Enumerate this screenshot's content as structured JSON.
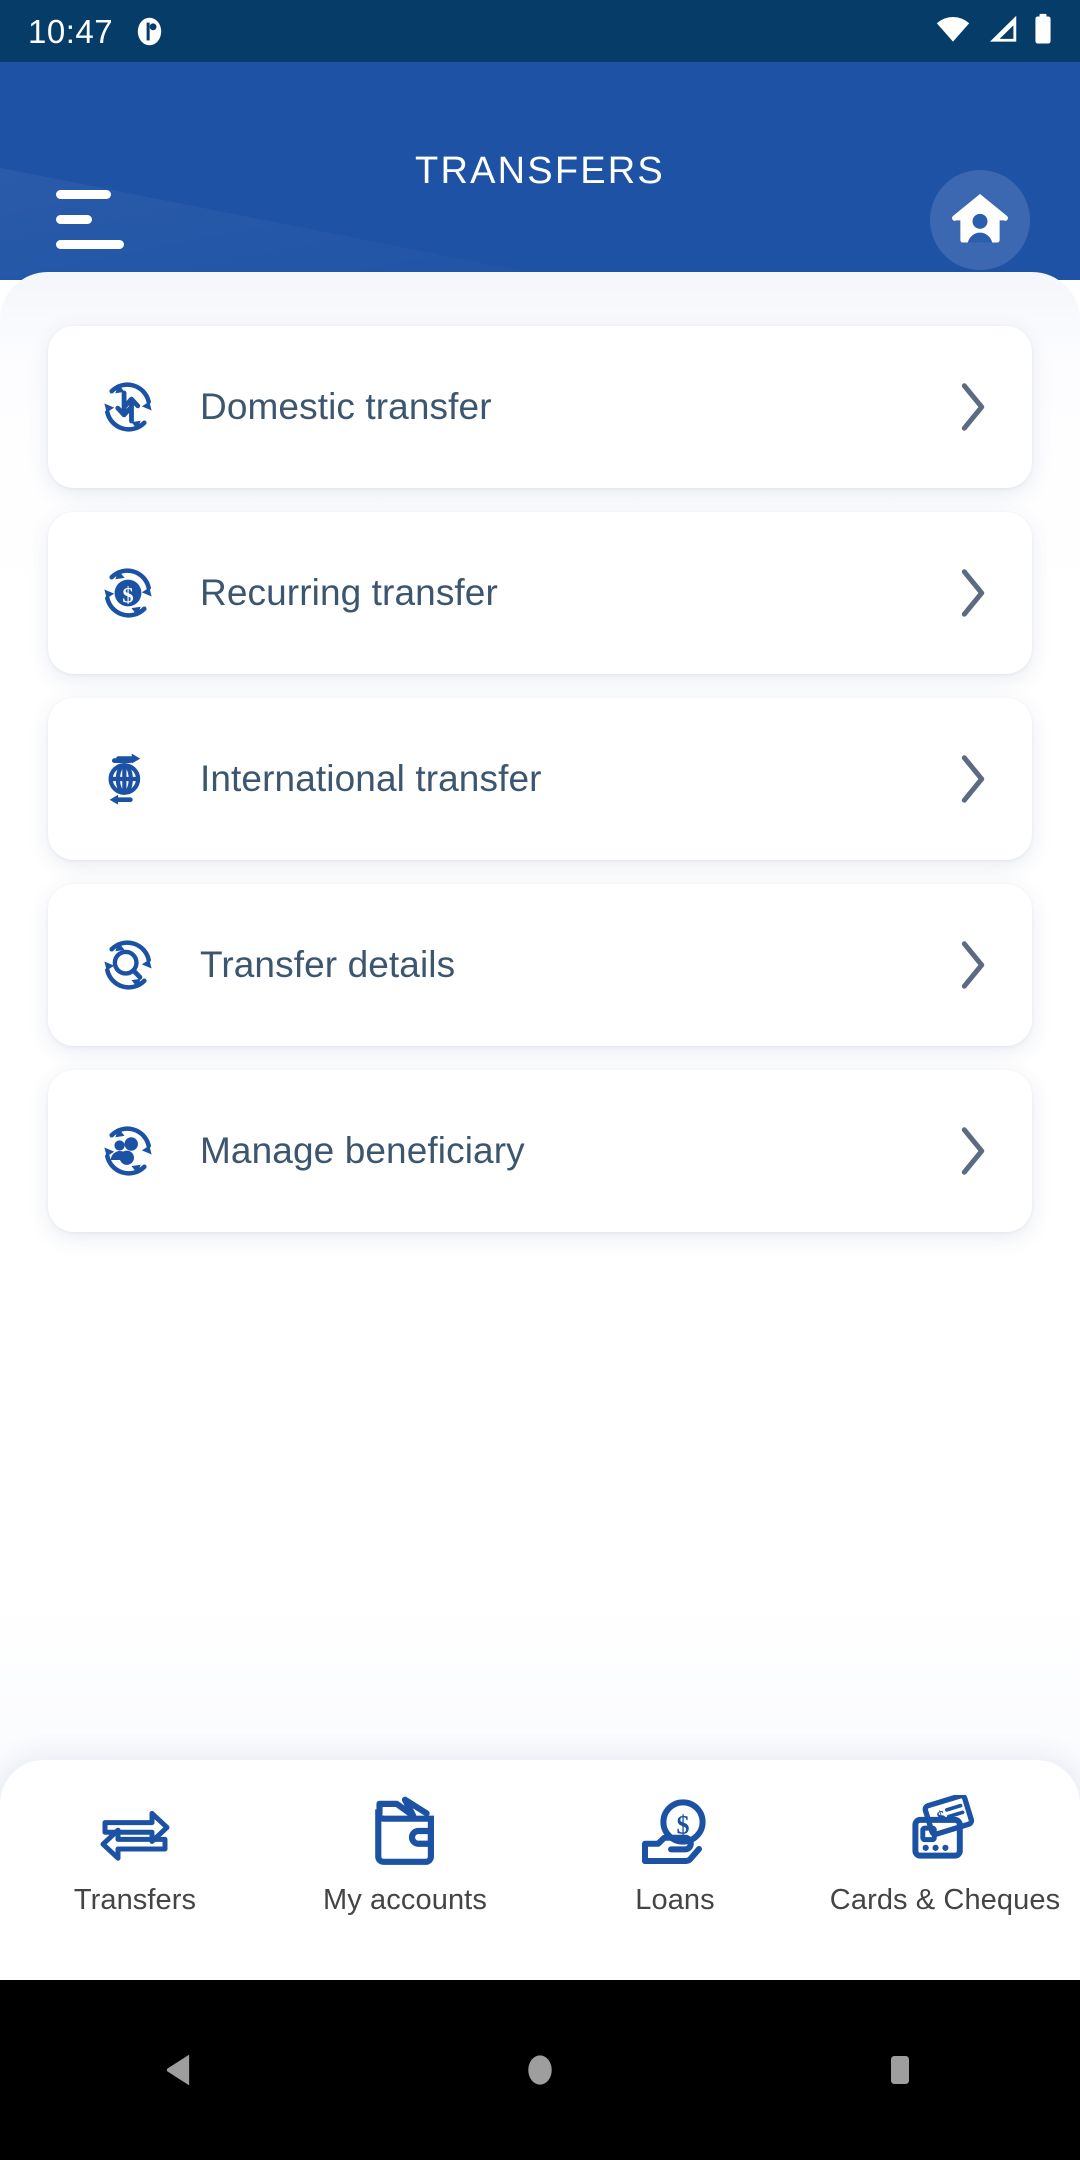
{
  "status_bar": {
    "time": "10:47",
    "app_icon": "notification-app-icon",
    "wifi_icon": "wifi-icon",
    "signal_icon": "cellular-signal-icon",
    "battery_icon": "battery-full-icon",
    "background_color": "#053c68"
  },
  "header": {
    "title": "TRANSFERS",
    "menu_icon": "hamburger-menu-icon",
    "home_icon": "home-person-icon",
    "background_color": "#1e52a5"
  },
  "menu_items": [
    {
      "label": "Domestic transfer",
      "icon": "domestic-transfer-icon",
      "chevron": "chevron-right-icon"
    },
    {
      "label": "Recurring transfer",
      "icon": "recurring-transfer-icon",
      "chevron": "chevron-right-icon"
    },
    {
      "label": "International transfer",
      "icon": "international-transfer-icon",
      "chevron": "chevron-right-icon"
    },
    {
      "label": "Transfer details",
      "icon": "transfer-details-icon",
      "chevron": "chevron-right-icon"
    },
    {
      "label": "Manage beneficiary",
      "icon": "manage-beneficiary-icon",
      "chevron": "chevron-right-icon"
    }
  ],
  "bottom_nav": [
    {
      "label": "Transfers",
      "icon": "transfers-arrows-icon"
    },
    {
      "label": "My accounts",
      "icon": "wallet-icon"
    },
    {
      "label": "Loans",
      "icon": "hand-coin-icon"
    },
    {
      "label": "Cards & Cheques",
      "icon": "cards-cheques-icon"
    }
  ],
  "android_nav": {
    "back": "back-triangle-icon",
    "home": "home-circle-icon",
    "recents": "recents-square-icon"
  },
  "colors": {
    "brand_blue": "#1e52a5",
    "status_dark_blue": "#053c68",
    "icon_blue": "#1c52a3",
    "text_slate": "#3c5670",
    "chevron_gray": "#5b6b82",
    "nav_label": "#444444"
  }
}
